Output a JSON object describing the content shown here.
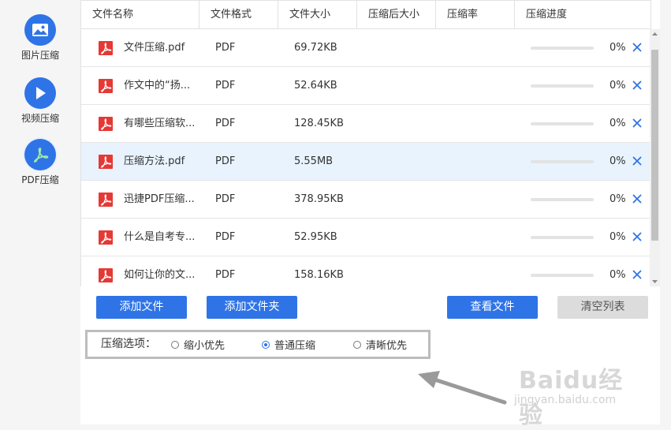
{
  "sidebar": {
    "items": [
      {
        "label": "图片压缩",
        "icon": "image-icon"
      },
      {
        "label": "视频压缩",
        "icon": "play-icon"
      },
      {
        "label": "PDF压缩",
        "icon": "pdf-icon"
      }
    ]
  },
  "table": {
    "headers": [
      "文件名称",
      "文件格式",
      "文件大小",
      "压缩后大小",
      "压缩率",
      "压缩进度"
    ],
    "rows": [
      {
        "name": "文件压缩.pdf",
        "format": "PDF",
        "size": "69.72KB",
        "compressed": "",
        "ratio": "",
        "progress": 0,
        "progress_text": "0%"
      },
      {
        "name": "作文中的“扬...",
        "format": "PDF",
        "size": "52.64KB",
        "compressed": "",
        "ratio": "",
        "progress": 0,
        "progress_text": "0%"
      },
      {
        "name": "有哪些压缩软...",
        "format": "PDF",
        "size": "128.45KB",
        "compressed": "",
        "ratio": "",
        "progress": 0,
        "progress_text": "0%"
      },
      {
        "name": "压缩方法.pdf",
        "format": "PDF",
        "size": "5.55MB",
        "compressed": "",
        "ratio": "",
        "progress": 0,
        "progress_text": "0%"
      },
      {
        "name": "迅捷PDF压缩...",
        "format": "PDF",
        "size": "378.95KB",
        "compressed": "",
        "ratio": "",
        "progress": 0,
        "progress_text": "0%"
      },
      {
        "name": "什么是自考专...",
        "format": "PDF",
        "size": "52.95KB",
        "compressed": "",
        "ratio": "",
        "progress": 0,
        "progress_text": "0%"
      },
      {
        "name": "如何让你的文...",
        "format": "PDF",
        "size": "158.16KB",
        "compressed": "",
        "ratio": "",
        "progress": 0,
        "progress_text": "0%"
      }
    ]
  },
  "buttons": {
    "add_file": "添加文件",
    "add_folder": "添加文件夹",
    "view_files": "查看文件",
    "clear_list": "清空列表"
  },
  "options": {
    "label": "压缩选项：",
    "choices": [
      "缩小优先",
      "普通压缩",
      "清晰优先"
    ],
    "selected": "普通压缩"
  },
  "watermark": {
    "brand": "Baidu经验",
    "url": "jingyan.baidu.com"
  },
  "colors": {
    "accent": "#2f74e6",
    "pdf_red": "#e53935",
    "selected_row": "#e8f3fe"
  }
}
